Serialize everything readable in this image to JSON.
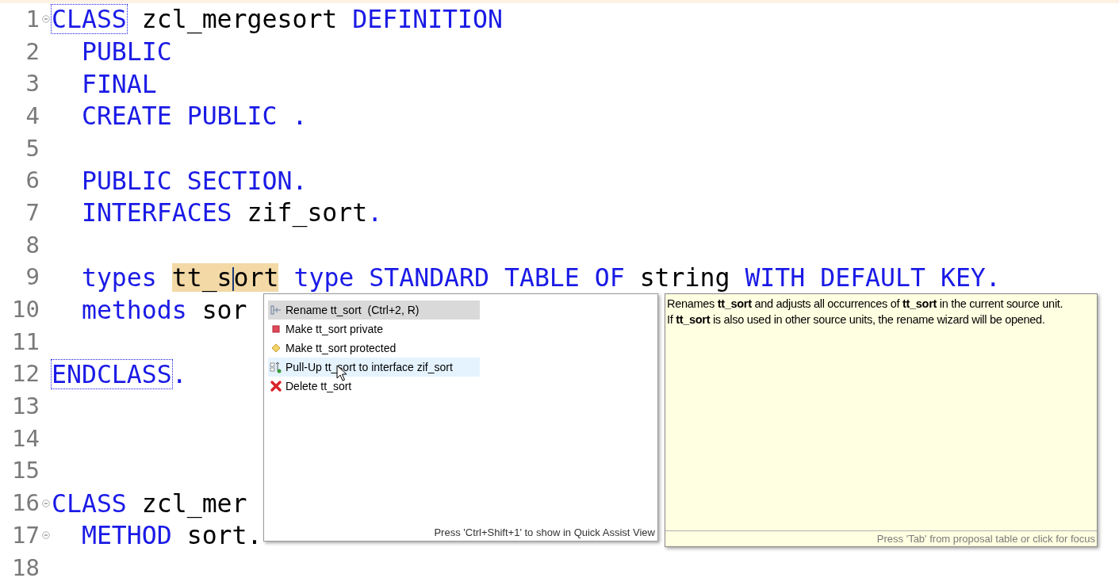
{
  "editor": {
    "lines": [
      {
        "number": "1",
        "fold": true,
        "tokens": [
          {
            "text": "CLASS",
            "kind": "keyword",
            "boxed": true
          },
          {
            "text": " zcl_mergesort ",
            "kind": "plain"
          },
          {
            "text": "DEFINITION",
            "kind": "keyword"
          }
        ]
      },
      {
        "number": "2",
        "tokens": [
          {
            "text": "  PUBLIC",
            "kind": "keyword"
          }
        ]
      },
      {
        "number": "3",
        "tokens": [
          {
            "text": "  FINAL",
            "kind": "keyword"
          }
        ]
      },
      {
        "number": "4",
        "tokens": [
          {
            "text": "  CREATE PUBLIC .",
            "kind": "keyword"
          }
        ]
      },
      {
        "number": "5"
      },
      {
        "number": "6",
        "tokens": [
          {
            "text": "  PUBLIC SECTION.",
            "kind": "keyword"
          }
        ]
      },
      {
        "number": "7",
        "tokens": [
          {
            "text": "  INTERFACES ",
            "kind": "keyword"
          },
          {
            "text": "zif_sort",
            "kind": "plain"
          },
          {
            "text": ".",
            "kind": "keyword"
          }
        ]
      },
      {
        "number": "8"
      },
      {
        "number": "9",
        "tokens": [
          {
            "text": "  types ",
            "kind": "keyword"
          },
          {
            "text": "tt_s",
            "kind": "plain",
            "highlight": true,
            "caret": true
          },
          {
            "text": "ort",
            "kind": "plain",
            "highlight": true
          },
          {
            "text": " type STANDARD TABLE OF ",
            "kind": "keyword"
          },
          {
            "text": "string",
            "kind": "plain"
          },
          {
            "text": " WITH DEFAULT KEY.",
            "kind": "keyword"
          }
        ]
      },
      {
        "number": "10",
        "tokens": [
          {
            "text": "  methods ",
            "kind": "keyword"
          },
          {
            "text": "sor",
            "kind": "plain"
          }
        ]
      },
      {
        "number": "11"
      },
      {
        "number": "12",
        "tokens": [
          {
            "text": "ENDCLASS",
            "kind": "keyword",
            "boxed": true
          },
          {
            "text": ".",
            "kind": "keyword"
          }
        ]
      },
      {
        "number": "13"
      },
      {
        "number": "14"
      },
      {
        "number": "15"
      },
      {
        "number": "16",
        "fold": true,
        "tokens": [
          {
            "text": "CLASS ",
            "kind": "keyword"
          },
          {
            "text": "zcl_mer",
            "kind": "plain"
          }
        ]
      },
      {
        "number": "17",
        "fold": true,
        "tokens": [
          {
            "text": "  METHOD ",
            "kind": "keyword"
          },
          {
            "text": "sort.",
            "kind": "plain"
          }
        ]
      },
      {
        "number": "18"
      }
    ]
  },
  "quick_assist": {
    "items": [
      {
        "kind": "rename",
        "label": "Rename tt_sort  (Ctrl+2, R)",
        "selected": true
      },
      {
        "kind": "private",
        "label": "Make tt_sort private",
        "selected": false
      },
      {
        "kind": "protected",
        "label": "Make tt_sort protected",
        "selected": false
      },
      {
        "kind": "pullup",
        "label": "Pull-Up tt_sort to interface zif_sort",
        "selected": false,
        "hovered": true
      },
      {
        "kind": "delete",
        "label": "Delete tt_sort",
        "selected": false
      }
    ],
    "hint": "Press 'Ctrl+Shift+1' to show in Quick Assist View"
  },
  "info_popup": {
    "lines": [
      "Renames **tt_sort** and adjusts all occurrences of **tt_sort** in the current source unit.",
      "If **tt_sort** is also used in other source units, the rename wizard will be opened."
    ],
    "hint": "Press 'Tab' from proposal table or click for focus"
  }
}
